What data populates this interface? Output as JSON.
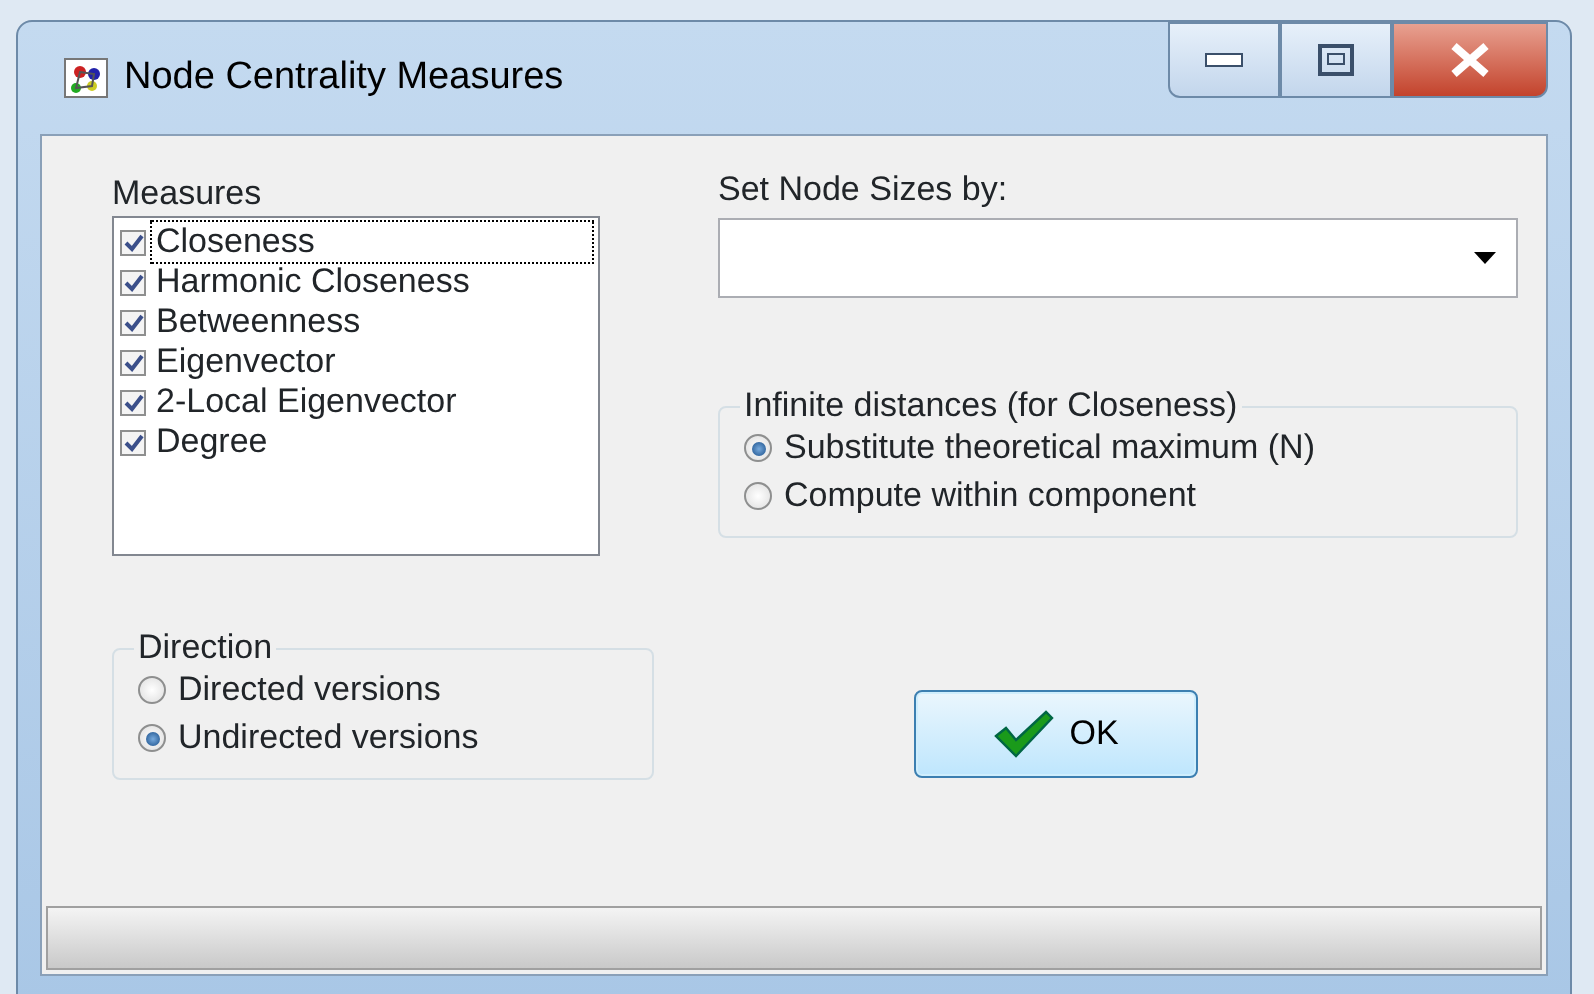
{
  "window": {
    "title": "Node Centrality Measures"
  },
  "measures": {
    "label": "Measures",
    "items": [
      {
        "label": "Closeness",
        "checked": true,
        "focused": true
      },
      {
        "label": "Harmonic Closeness",
        "checked": true,
        "focused": false
      },
      {
        "label": "Betweenness",
        "checked": true,
        "focused": false
      },
      {
        "label": "Eigenvector",
        "checked": true,
        "focused": false
      },
      {
        "label": "2-Local Eigenvector",
        "checked": true,
        "focused": false
      },
      {
        "label": "Degree",
        "checked": true,
        "focused": false
      }
    ]
  },
  "node_sizes": {
    "label": "Set Node Sizes by:"
  },
  "infinite_distances": {
    "label": "Infinite distances (for Closeness)",
    "options": [
      {
        "label": "Substitute theoretical maximum (N)",
        "selected": true
      },
      {
        "label": "Compute within component",
        "selected": false
      }
    ]
  },
  "direction": {
    "label": "Direction",
    "options": [
      {
        "label": "Directed versions",
        "selected": false
      },
      {
        "label": "Undirected versions",
        "selected": true
      }
    ]
  },
  "ok_button": {
    "label": "OK"
  }
}
